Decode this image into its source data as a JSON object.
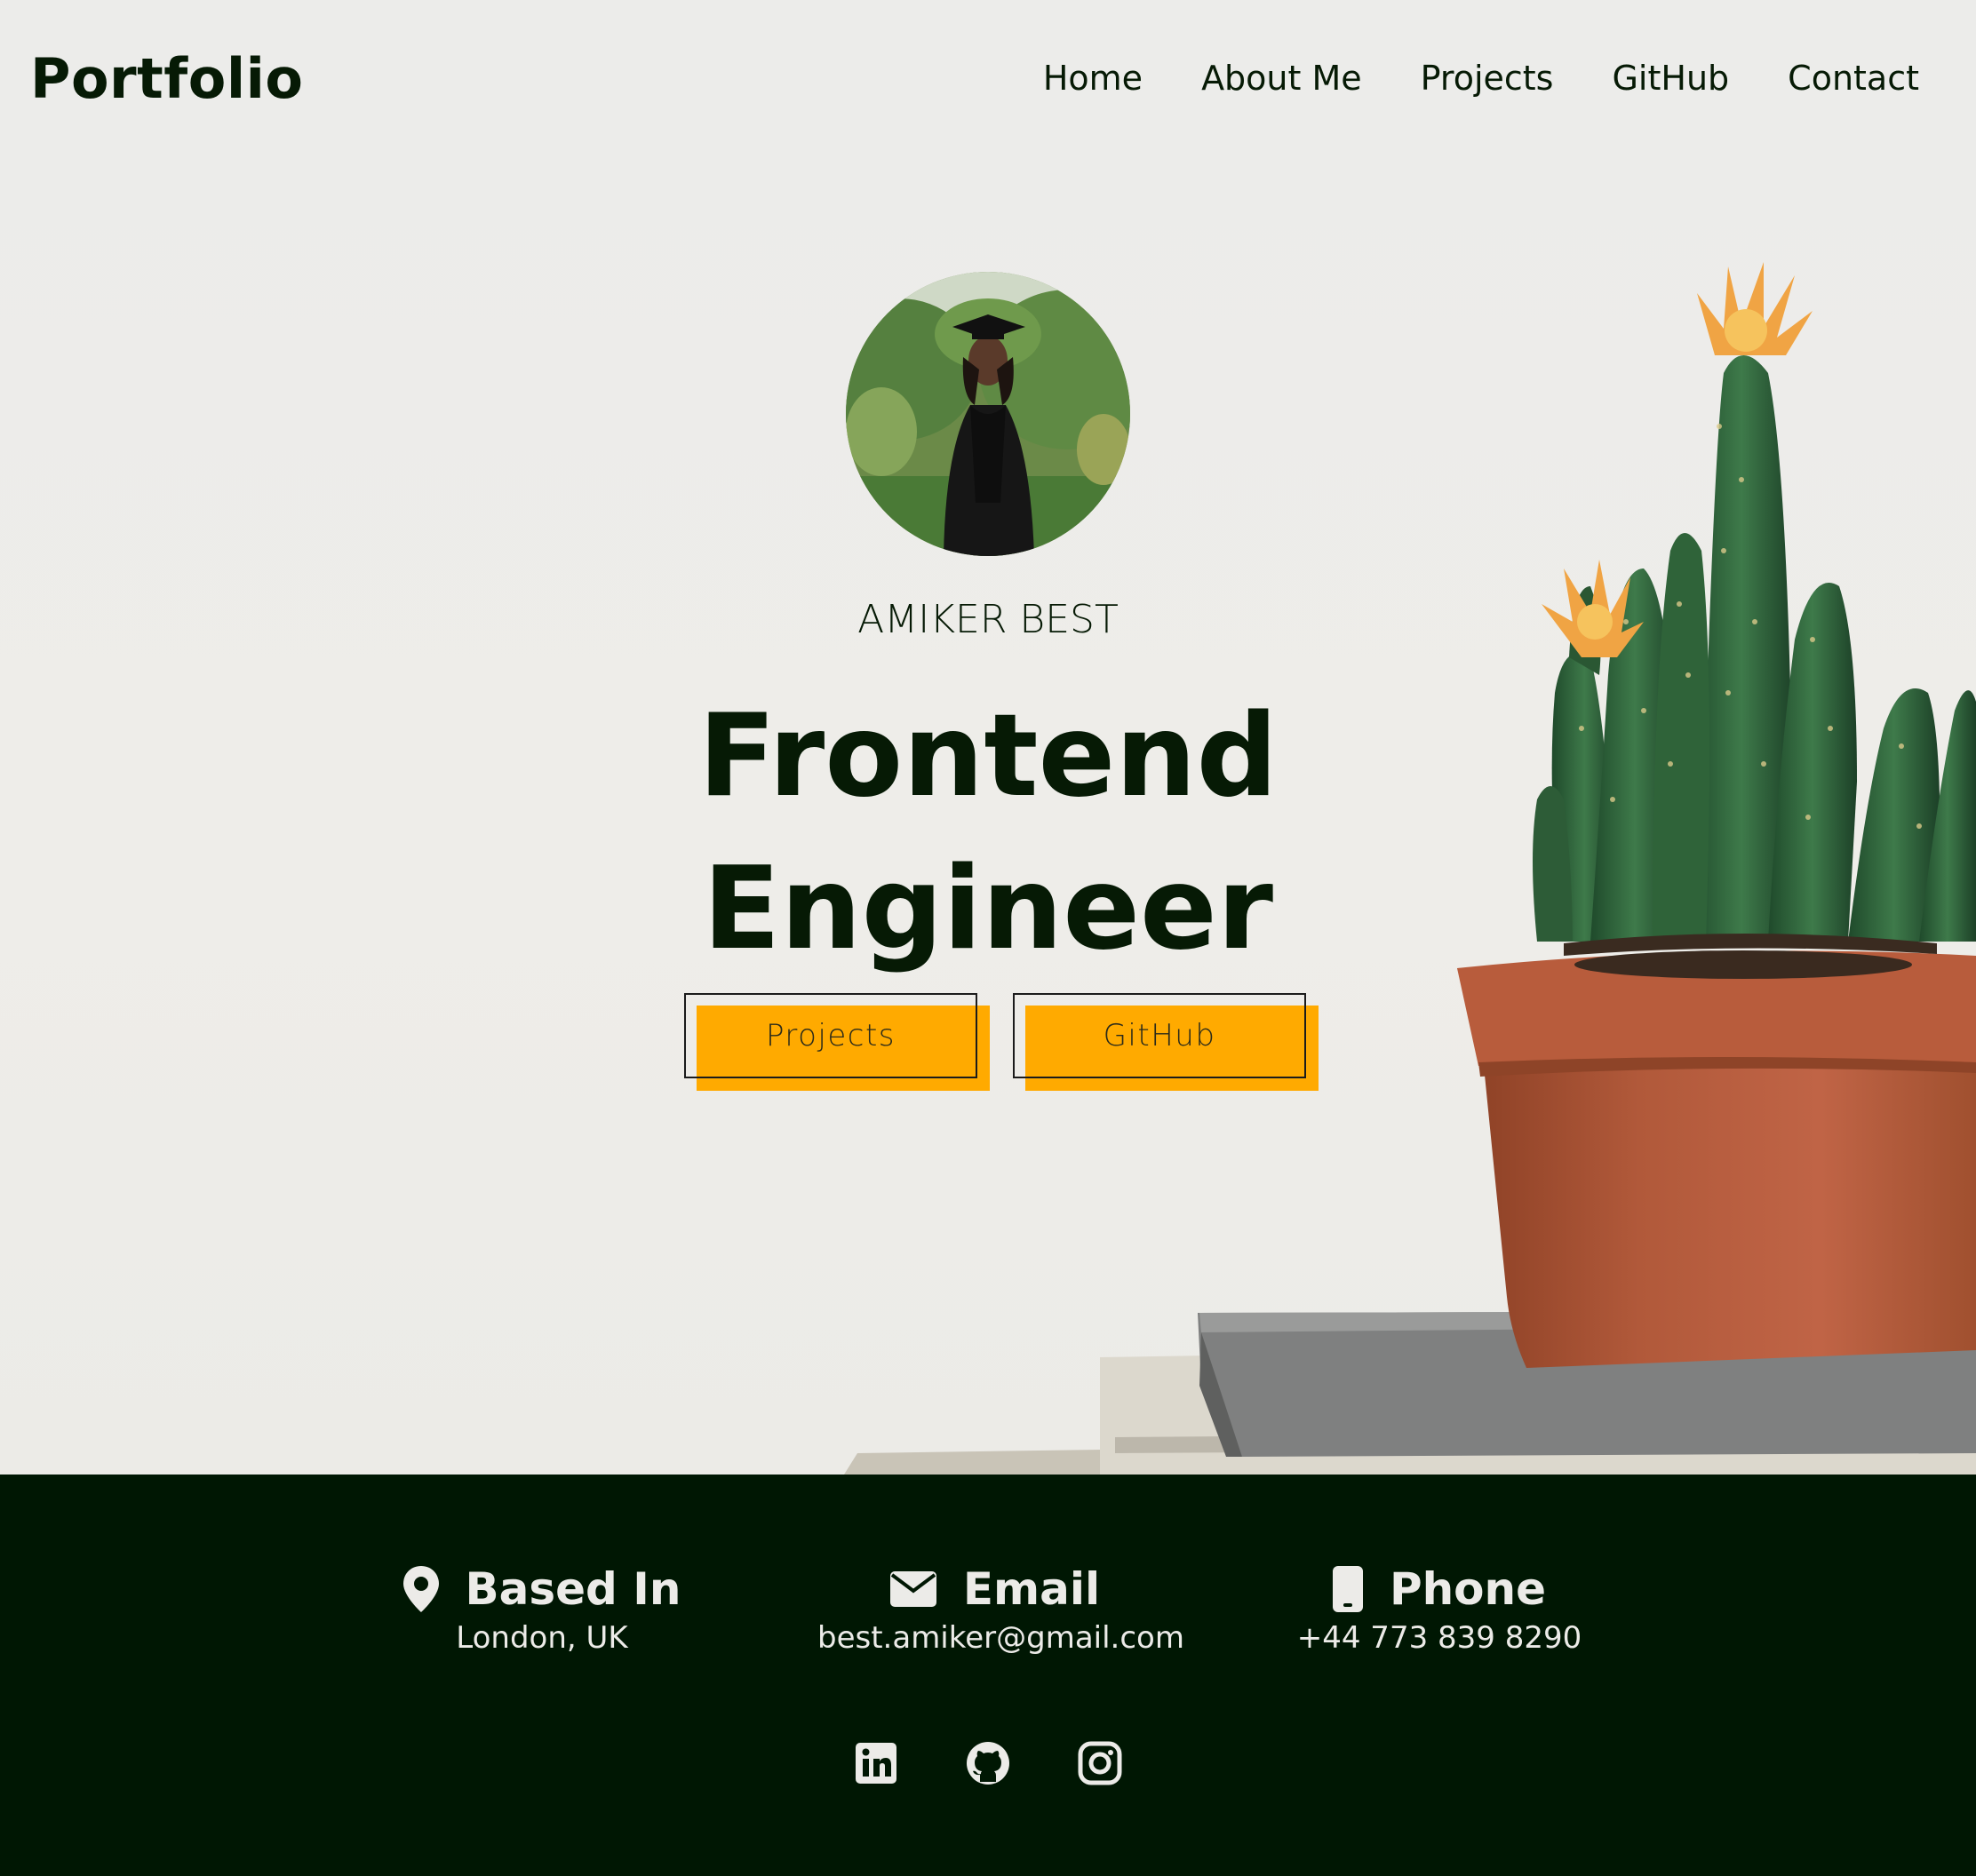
{
  "header": {
    "brand": "Portfolio",
    "nav": [
      "Home",
      "About Me",
      "Projects",
      "GitHub",
      "Contact"
    ]
  },
  "hero": {
    "name": "AMIKER BEST",
    "headline_line1": "Frontend",
    "headline_line2": "Engineer",
    "buttons": {
      "projects": "Projects",
      "github": "GitHub"
    }
  },
  "contact": {
    "based_in": {
      "title": "Based In",
      "value": "London, UK",
      "icon": "location-pin-icon"
    },
    "email": {
      "title": "Email",
      "value": "best.amiker@gmail.com",
      "icon": "envelope-icon"
    },
    "phone": {
      "title": "Phone",
      "value": "+44 773 839 8290",
      "icon": "mobile-phone-icon"
    }
  },
  "socials": [
    "linkedin-icon",
    "github-icon",
    "instagram-icon"
  ],
  "colors": {
    "brand_dark": "#061a05",
    "footer_bg": "#001703",
    "accent": "#ffaa00",
    "hero_bg": "#ecebe8"
  }
}
